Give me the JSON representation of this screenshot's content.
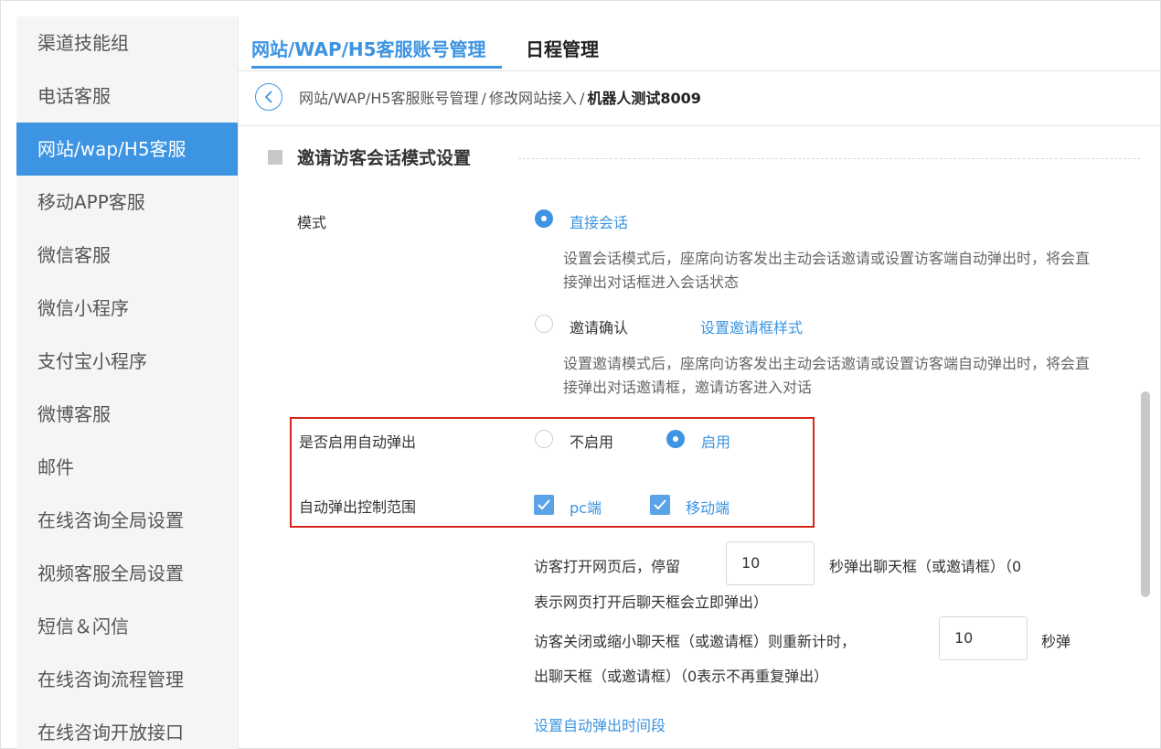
{
  "sidebar": {
    "items": [
      {
        "label": "渠道技能组",
        "active": false
      },
      {
        "label": "电话客服",
        "active": false
      },
      {
        "label": "网站/wap/H5客服",
        "active": true
      },
      {
        "label": "移动APP客服",
        "active": false
      },
      {
        "label": "微信客服",
        "active": false
      },
      {
        "label": "微信小程序",
        "active": false
      },
      {
        "label": "支付宝小程序",
        "active": false
      },
      {
        "label": "微博客服",
        "active": false
      },
      {
        "label": "邮件",
        "active": false
      },
      {
        "label": "在线咨询全局设置",
        "active": false
      },
      {
        "label": "视频客服全局设置",
        "active": false
      },
      {
        "label": "短信＆闪信",
        "active": false
      },
      {
        "label": "在线咨询流程管理",
        "active": false
      },
      {
        "label": "在线咨询开放接口",
        "active": false
      }
    ]
  },
  "tabs": [
    {
      "label": "网站/WAP/H5客服账号管理",
      "active": true
    },
    {
      "label": "日程管理",
      "active": false
    }
  ],
  "breadcrumb": {
    "items": [
      "网站/WAP/H5客服账号管理",
      "修改网站接入"
    ],
    "current": "机器人测试8009",
    "separator": "/"
  },
  "section": {
    "title": "邀请访客会话模式设置"
  },
  "mode": {
    "label": "模式",
    "option_direct": "直接会话",
    "option_direct_selected": true,
    "direct_desc": "设置会话模式后，座席向访客发出主动会话邀请或设置访客端自动弹出时，将会直接弹出对话框进入会话状态",
    "option_invite": "邀请确认",
    "option_invite_selected": false,
    "invite_link": "设置邀请框样式",
    "invite_desc": "设置邀请模式后，座席向访客发出主动会话邀请或设置访客端自动弹出时，将会直接弹出对话邀请框，邀请访客进入对话"
  },
  "auto_popup": {
    "label": "是否启用自动弹出",
    "option_off": "不启用",
    "option_on": "启用",
    "enabled": true
  },
  "popup_scope": {
    "label": "自动弹出控制范围",
    "pc": "pc端",
    "pc_checked": true,
    "mobile": "移动端",
    "mobile_checked": true
  },
  "stay": {
    "prefix": "访客打开网页后，停留",
    "value": "10",
    "suffix": "秒弹出聊天框（或邀请框）（0",
    "note": "表示网页打开后聊天框会立即弹出）"
  },
  "reset": {
    "prefix": "访客关闭或缩小聊天框（或邀请框）则重新计时，",
    "value": "10",
    "suffix": "秒弹",
    "note": "出聊天框（或邀请框）（0表示不再重复弹出）"
  },
  "time_link": "设置自动弹出时间段",
  "colors": {
    "accent": "#3c94e2",
    "highlight_border": "#d9251c",
    "sidebar_bg": "#f5f5f5"
  }
}
